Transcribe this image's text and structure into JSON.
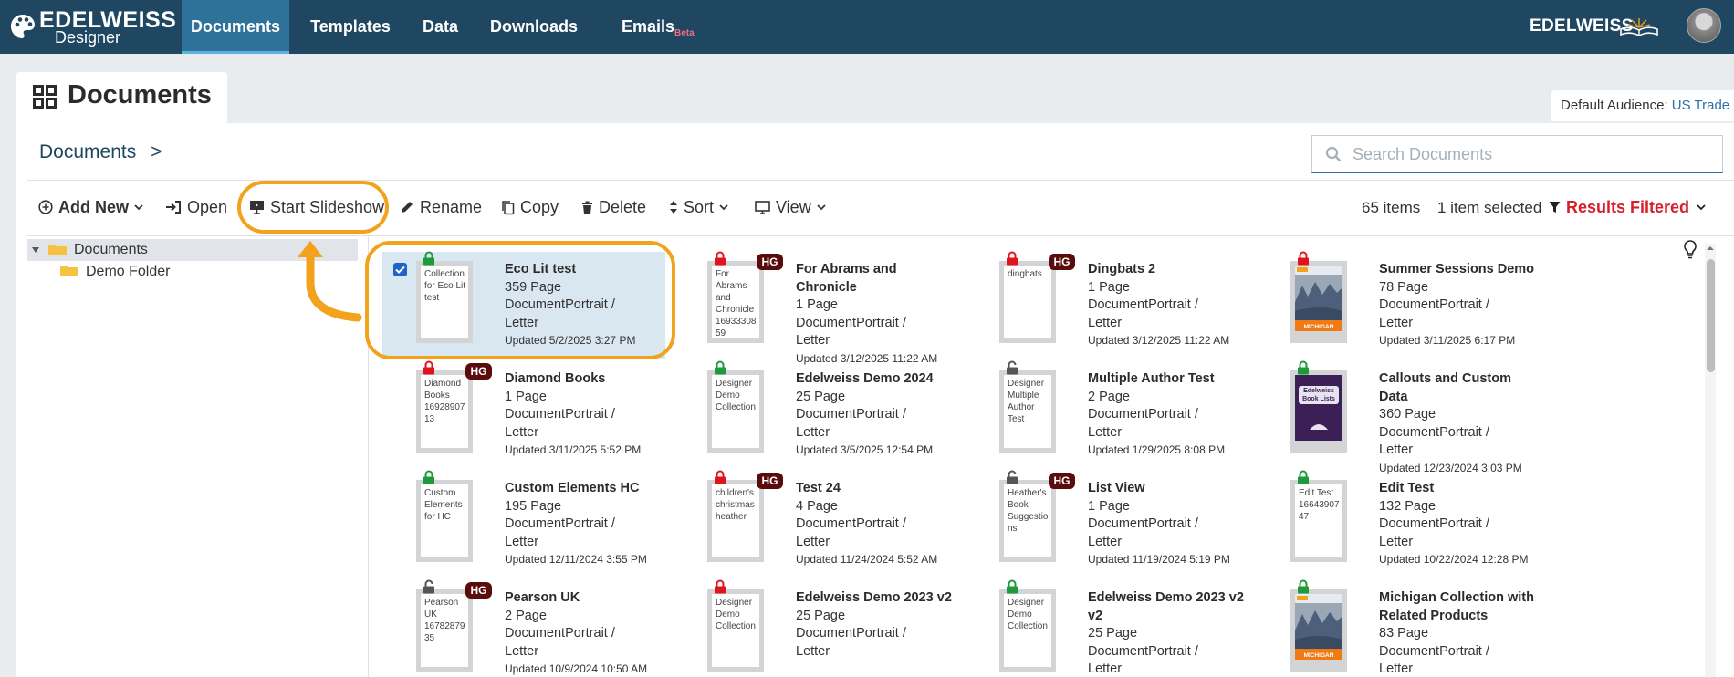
{
  "nav": {
    "brand_line1": "EDELWEISS",
    "brand_line2": "Designer",
    "tabs": [
      {
        "label": "Documents",
        "active": true
      },
      {
        "label": "Templates"
      },
      {
        "label": "Data"
      },
      {
        "label": "Downloads"
      },
      {
        "label": "Emails",
        "badge": "Beta"
      }
    ],
    "brand_right": "EDELWEISS"
  },
  "page": {
    "title": "Documents",
    "audience_label": "Default Audience:",
    "audience_value": "US Trade"
  },
  "breadcrumb": {
    "label": "Documents",
    "separator": ">"
  },
  "search": {
    "placeholder": "Search Documents",
    "value": ""
  },
  "toolbar": {
    "add_new": "Add New",
    "open": "Open",
    "slideshow": "Start Slideshow",
    "rename": "Rename",
    "copy": "Copy",
    "delete": "Delete",
    "sort": "Sort",
    "view": "View",
    "item_count": "65 items",
    "selected_count": "1 item selected",
    "filter_label": "Results Filtered"
  },
  "tree": [
    {
      "label": "Documents",
      "expanded": true,
      "selected": true
    },
    {
      "label": "Demo Folder"
    }
  ],
  "colors": {
    "nav_bg": "#1f4761",
    "nav_active": "#2e7199",
    "filter_red": "#d4212c",
    "highlight": "#f2a21c",
    "lock_green": "#1f9a3a",
    "lock_red": "#e0141e",
    "lock_gray": "#555555",
    "hg_badge": "#5a0b0b"
  },
  "documents": [
    {
      "title": "Eco Lit test",
      "pages": "359 Page",
      "format1": "DocumentPortrait /",
      "format2": "Letter",
      "updated": "Updated 5/2/2025 3:27 PM",
      "thumb_text": "Collection for Eco Lit test",
      "lock": "green",
      "hg": "",
      "selected": true
    },
    {
      "title": "For Abrams and Chronicle",
      "pages": "1 Page",
      "format1": "DocumentPortrait /",
      "format2": "Letter",
      "updated": "Updated 3/12/2025 11:22 AM",
      "thumb_text": "For Abrams and Chronicle 1693330859",
      "lock": "red",
      "hg": "HG"
    },
    {
      "title": "Dingbats 2",
      "pages": "1 Page",
      "format1": "DocumentPortrait /",
      "format2": "Letter",
      "updated": "Updated 3/12/2025 11:22 AM",
      "thumb_text": "dingbats",
      "lock": "red",
      "hg": "HG"
    },
    {
      "title": "Summer Sessions Demo",
      "pages": "78 Page",
      "format1": "DocumentPortrait /",
      "format2": "Letter",
      "updated": "Updated 3/11/2025 6:17 PM",
      "thumb_text": "",
      "cover": "michigan",
      "cover_text": "MICHIGAN",
      "lock": "red",
      "hg": ""
    },
    {
      "title": "Diamond Books",
      "pages": "1 Page",
      "format1": "DocumentPortrait /",
      "format2": "Letter",
      "updated": "Updated 3/11/2025 5:52 PM",
      "thumb_text": "Diamond Books 1692890713",
      "lock": "red",
      "hg": "HG"
    },
    {
      "title": "Edelweiss Demo 2024",
      "pages": "25 Page",
      "format1": "DocumentPortrait /",
      "format2": "Letter",
      "updated": "Updated 3/5/2025 12:54 PM",
      "thumb_text": "Designer Demo Collection",
      "lock": "green",
      "hg": ""
    },
    {
      "title": "Multiple Author Test",
      "pages": "2 Page",
      "format1": "DocumentPortrait /",
      "format2": "Letter",
      "updated": "Updated 1/29/2025 8:08 PM",
      "thumb_text": "Designer Multiple Author Test",
      "lock": "gray",
      "hg": ""
    },
    {
      "title": "Callouts and Custom Data",
      "pages": "360 Page",
      "format1": "DocumentPortrait /",
      "format2": "Letter",
      "updated": "Updated 12/23/2024 3:03 PM",
      "thumb_text": "",
      "cover": "booklists",
      "cover_text": "Edelweiss Book Lists",
      "lock": "green",
      "hg": ""
    },
    {
      "title": "Custom Elements HC",
      "pages": "195 Page",
      "format1": "DocumentPortrait /",
      "format2": "Letter",
      "updated": "Updated 12/11/2024 3:55 PM",
      "thumb_text": "Custom Elements for HC",
      "lock": "green",
      "hg": ""
    },
    {
      "title": "Test 24",
      "pages": "4 Page",
      "format1": "DocumentPortrait /",
      "format2": "Letter",
      "updated": "Updated 11/24/2024 5:52 AM",
      "thumb_text": "children's christmas heather",
      "lock": "red",
      "hg": "HG"
    },
    {
      "title": "List View",
      "pages": "1 Page",
      "format1": "DocumentPortrait /",
      "format2": "Letter",
      "updated": "Updated 11/19/2024 5:19 PM",
      "thumb_text": "Heather's Book Suggestions",
      "lock": "gray",
      "hg": "HG"
    },
    {
      "title": "Edit Test",
      "pages": "132 Page",
      "format1": "DocumentPortrait /",
      "format2": "Letter",
      "updated": "Updated 10/22/2024 12:28 PM",
      "thumb_text": "Edit Test 1664390747",
      "lock": "green",
      "hg": ""
    },
    {
      "title": "Pearson UK",
      "pages": "2 Page",
      "format1": "DocumentPortrait /",
      "format2": "Letter",
      "updated": "Updated 10/9/2024 10:50 AM",
      "thumb_text": "Pearson UK 1678287935",
      "lock": "gray",
      "hg": "HG"
    },
    {
      "title": "Edelweiss Demo 2023 v2",
      "pages": "25 Page",
      "format1": "DocumentPortrait /",
      "format2": "Letter",
      "updated": "",
      "thumb_text": "Designer Demo Collection",
      "lock": "red",
      "hg": ""
    },
    {
      "title": "Edelweiss Demo 2023 v2 v2",
      "pages": "25 Page",
      "format1": "DocumentPortrait /",
      "format2": "Letter",
      "updated": "",
      "thumb_text": "Designer Demo Collection",
      "lock": "green",
      "hg": ""
    },
    {
      "title": "Michigan Collection with Related Products",
      "pages": "83 Page",
      "format1": "DocumentPortrait /",
      "format2": "Letter",
      "updated": "",
      "thumb_text": "",
      "cover": "michigan",
      "cover_text": "MICHIGAN",
      "lock": "green",
      "hg": ""
    }
  ]
}
